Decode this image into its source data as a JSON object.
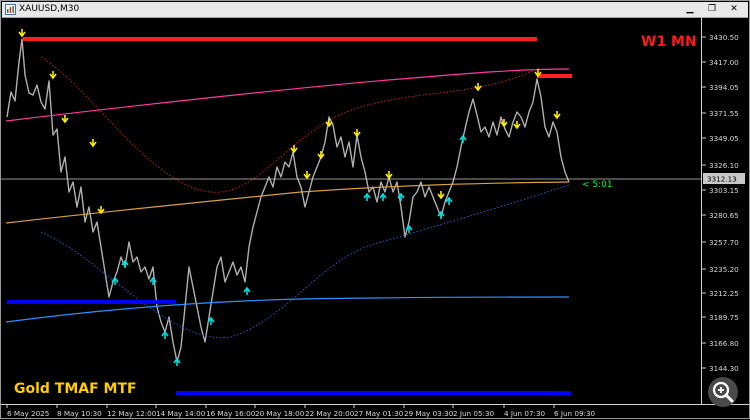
{
  "window": {
    "title": "XAUUSD,M30",
    "minimize_glyph": "▁",
    "restore_glyph": "❐",
    "close_glyph": "✕"
  },
  "overlay": {
    "timeframes_label": "W1 MN",
    "indicator_label": "Gold TMAF MTF",
    "bar_countdown": "< 5:01"
  },
  "price_axis": {
    "labels": [
      "3430.50",
      "3417.00",
      "3394.05",
      "3371.55",
      "3349.05",
      "3326.10",
      "3303.15",
      "3280.65",
      "3257.70",
      "3235.20",
      "3212.25",
      "3189.75",
      "3166.80",
      "3144.30"
    ],
    "current_price": "3312.13"
  },
  "time_axis": {
    "labels": [
      "6 May 2025",
      "8 May 10:30",
      "12 May 12:00",
      "14 May 14:00",
      "16 May 16:00",
      "20 May 18:00",
      "22 May 20:00",
      "27 May 01:30",
      "29 May 03:30",
      "2 Jun 05:30",
      "4 Jun 07:30",
      "6 Jun 09:30"
    ]
  },
  "colors": {
    "background": "#000000",
    "price_series": "#b0b0b0",
    "upper_band": "#ff2020",
    "lower_band": "#0000ff",
    "ma_pink": "#ff3aa0",
    "ma_orange": "#d9a040",
    "ma_blue": "#2f8fff",
    "dotted_red": "#cc2020",
    "dotted_blue": "#2a5fd0",
    "arrow_down": "#ffee00",
    "arrow_up": "#00e0e0"
  },
  "icons": {
    "app": "chart-window-icon",
    "zoom": "magnifier-zoom-icon"
  }
}
